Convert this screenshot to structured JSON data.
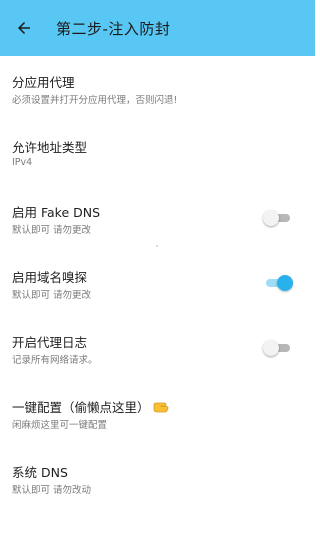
{
  "header": {
    "title": "第二步-注入防封",
    "back_icon": "arrow-left-icon",
    "background": "#58c7f3"
  },
  "settings": [
    {
      "title": "分应用代理",
      "subtitle": "必须设置并打开分应用代理，否则闪退!",
      "control": "none"
    },
    {
      "title": "允许地址类型",
      "subtitle": "IPv4",
      "control": "none"
    },
    {
      "title": "启用 Fake DNS",
      "subtitle": "默认即可 请勿更改",
      "control": "switch",
      "checked": false
    },
    {
      "title": "启用域名嗅探",
      "subtitle": "默认即可 请勿更改",
      "control": "switch",
      "checked": true
    },
    {
      "title": "开启代理日志",
      "subtitle": "记录所有网络请求。",
      "control": "switch",
      "checked": false
    },
    {
      "title": "一键配置（偷懒点这里）",
      "subtitle": "闲麻烦这里可一键配置",
      "control": "none",
      "icon": "pointing-hand-icon"
    },
    {
      "title": "系统 DNS",
      "subtitle": "默认即可 请勿改动",
      "control": "none"
    }
  ],
  "colors": {
    "accent": "#29b1ec",
    "switch_off": "#b7b7b7"
  }
}
